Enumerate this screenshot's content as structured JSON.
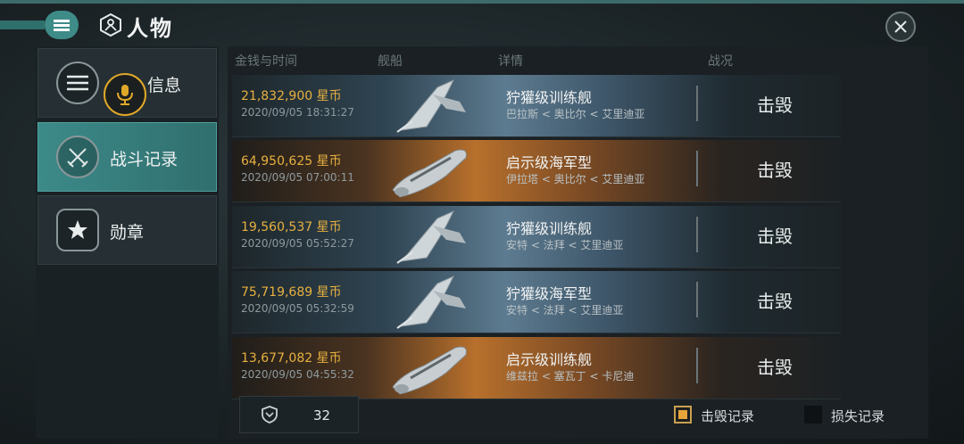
{
  "header": {
    "title": "人物"
  },
  "sidebar": {
    "items": [
      {
        "label": "信息",
        "icon": "list-icon"
      },
      {
        "label": "战斗记录",
        "icon": "crossed-swords-icon"
      },
      {
        "label": "勋章",
        "icon": "star-badge-icon"
      }
    ],
    "voice_icon": "microphone-icon"
  },
  "table": {
    "headers": {
      "money_time": "金钱与时间",
      "ship": "舰船",
      "details": "详情",
      "status": "战况"
    },
    "rows": [
      {
        "money": "21,832,900 星币",
        "time": "2020/09/05 18:31:27",
        "ship": "狞獾级训练舰",
        "route": "巴拉斯 < 奥比尔 < 艾里迪亚",
        "status": "击毁",
        "bg": "blue"
      },
      {
        "money": "64,950,625 星币",
        "time": "2020/09/05 07:00:11",
        "ship": "启示级海军型",
        "route": "伊拉塔 < 奥比尔 < 艾里迪亚",
        "status": "击毁",
        "bg": "amber"
      },
      {
        "money": "19,560,537 星币",
        "time": "2020/09/05 05:52:27",
        "ship": "狞獾级训练舰",
        "route": "安特 < 法拜 < 艾里迪亚",
        "status": "击毁",
        "bg": "blue"
      },
      {
        "money": "75,719,689 星币",
        "time": "2020/09/05 05:32:59",
        "ship": "狞獾级海军型",
        "route": "安特 < 法拜 < 艾里迪亚",
        "status": "击毁",
        "bg": "blue"
      },
      {
        "money": "13,677,082 星币",
        "time": "2020/09/05 04:55:32",
        "ship": "启示级训练舰",
        "route": "维兹拉 < 塞瓦丁 < 卡尼迪",
        "status": "击毁",
        "bg": "amber"
      }
    ]
  },
  "footer": {
    "count": "32",
    "count_icon": "shield-icon",
    "legend": [
      {
        "label": "击毁记录",
        "color": "#e8a53a",
        "checked": true
      },
      {
        "label": "损失记录",
        "color": "#0e1214",
        "checked": false
      }
    ]
  },
  "colors": {
    "accent": "#3e8b88",
    "money": "#e8b03f",
    "highlight": "#e0a829"
  }
}
